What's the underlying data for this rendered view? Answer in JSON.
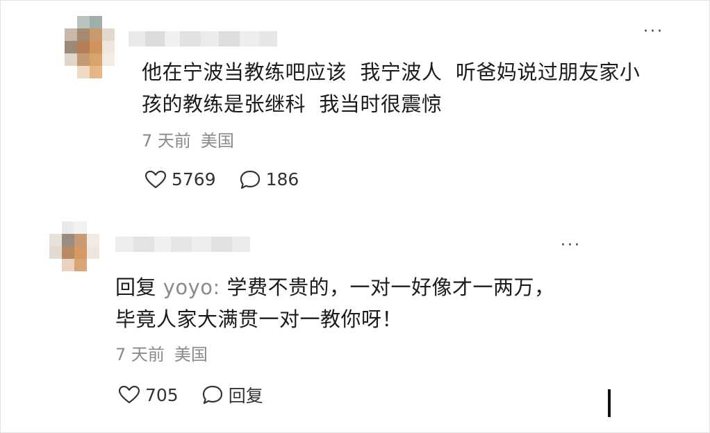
{
  "comments": [
    {
      "text": "他在宁波当教练吧应该  我宁波人  听爸妈说过朋友家小\n孩的教练是张继科  我当时很震惊",
      "time": "7 天前",
      "location": "美国",
      "like_count": "5769",
      "reply_count": "186",
      "icons": {
        "more": "more-dots-icon",
        "like": "heart-icon",
        "reply": "comment-bubble-icon"
      }
    },
    {
      "reply_prefix": "回复",
      "reply_to": "yoyo:",
      "text": " 学费不贵的，一对一好像才一两万，\n毕竟人家大满贯一对一教你呀！",
      "time": "7 天前",
      "location": "美国",
      "like_count": "705",
      "reply_label": "回复",
      "icons": {
        "more": "more-dots-icon",
        "like": "heart-icon",
        "reply": "comment-bubble-icon"
      }
    }
  ],
  "more_glyph": "···",
  "colors": {
    "text": "#1b1b1b",
    "meta": "#8a8a8a",
    "background": "#ffffff"
  }
}
